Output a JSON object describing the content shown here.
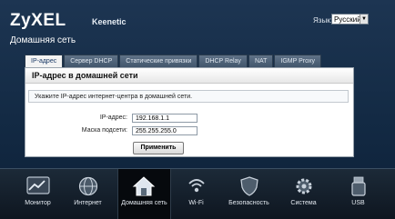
{
  "header": {
    "logo": "ZyXEL",
    "product": "Keenetic",
    "language_label": "Язык:",
    "language_value": "Русский",
    "page_title": "Домашняя сеть"
  },
  "tabs": [
    {
      "label": "IP-адрес",
      "active": true
    },
    {
      "label": "Сервер DHCP"
    },
    {
      "label": "Статические привязки"
    },
    {
      "label": "DHCP Relay"
    },
    {
      "label": "NAT"
    },
    {
      "label": "IGMP Proxy"
    }
  ],
  "panel": {
    "title": "IP-адрес в домашней сети",
    "hint": "Укажите IP-адрес интернет-центра в домашней сети.",
    "ip_label": "IP-адрес:",
    "ip_value": "192.168.1.1",
    "mask_label": "Маска подсети:",
    "mask_value": "255.255.255.0",
    "apply_label": "Применить"
  },
  "dock": [
    {
      "label": "Монитор",
      "icon": "monitor-chart-icon"
    },
    {
      "label": "Интернет",
      "icon": "globe-icon"
    },
    {
      "label": "Домашняя сеть",
      "icon": "home-icon",
      "active": true
    },
    {
      "label": "Wi-Fi",
      "icon": "wifi-icon"
    },
    {
      "label": "Безопасность",
      "icon": "shield-icon"
    },
    {
      "label": "Система",
      "icon": "gear-icon"
    },
    {
      "label": "USB",
      "icon": "usb-drive-icon"
    }
  ]
}
